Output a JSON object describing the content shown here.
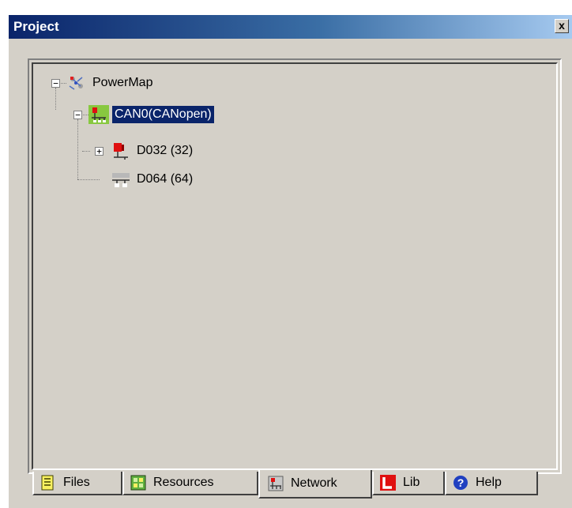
{
  "window": {
    "title": "Project",
    "close_label": "x"
  },
  "tree": {
    "root": {
      "label": "PowerMap",
      "expander": "−",
      "icon": "network-map-icon"
    },
    "can": {
      "label": "CAN0(CANopen)",
      "expander": "−",
      "icon": "can-bus-icon",
      "selected": true
    },
    "children": [
      {
        "label": "D032 (32)",
        "expander": "+",
        "icon": "device-red-icon"
      },
      {
        "label": "D064 (64)",
        "icon": "device-grey-icon"
      }
    ]
  },
  "tabs": [
    {
      "label": "Files",
      "icon": "files-icon",
      "active": false
    },
    {
      "label": "Resources",
      "icon": "resources-icon",
      "active": false
    },
    {
      "label": "Network",
      "icon": "network-icon",
      "active": true
    },
    {
      "label": "Lib",
      "icon": "lib-icon",
      "active": false
    },
    {
      "label": "Help",
      "icon": "help-icon",
      "active": false
    }
  ],
  "colors": {
    "titlebar_start": "#0a246a",
    "titlebar_end": "#a6caf0",
    "selection": "#0a246a",
    "face": "#d4d0c8"
  }
}
